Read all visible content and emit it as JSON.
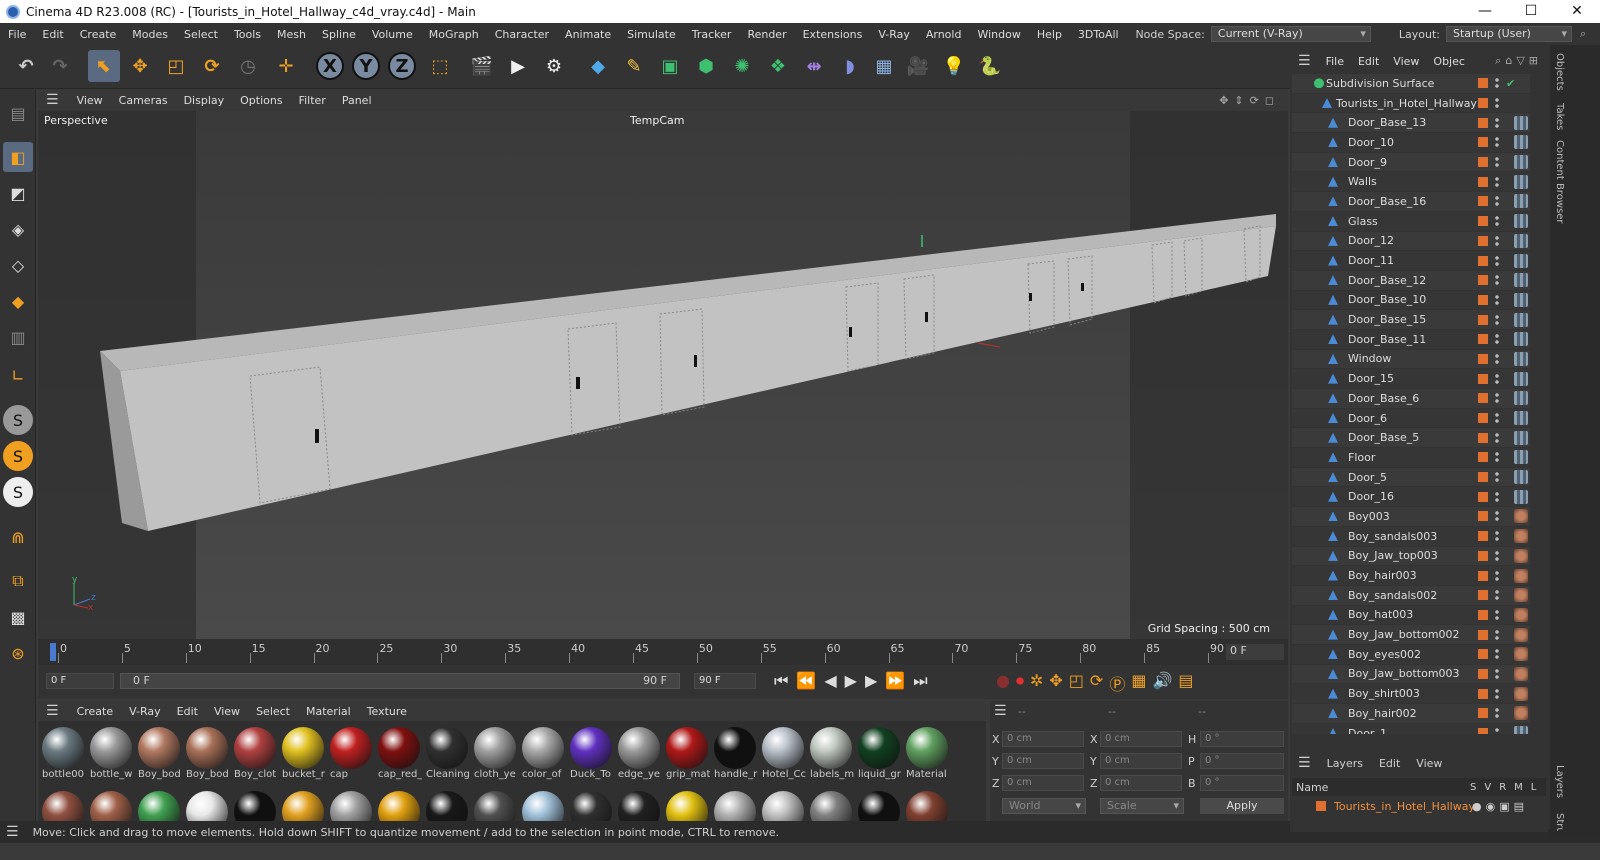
{
  "window": {
    "title": "Cinema 4D R23.008 (RC) - [Tourists_in_Hotel_Hallway_c4d_vray.c4d] - Main",
    "min": "—",
    "max": "☐",
    "close": "✕"
  },
  "menu": [
    "File",
    "Edit",
    "Create",
    "Modes",
    "Select",
    "Tools",
    "Mesh",
    "Spline",
    "Volume",
    "MoGraph",
    "Character",
    "Animate",
    "Simulate",
    "Tracker",
    "Render",
    "Extensions",
    "V-Ray",
    "Arnold",
    "Window",
    "Help",
    "3DToAll"
  ],
  "nodespace": {
    "label": "Node Space:",
    "value": "Current (V-Ray)"
  },
  "layout": {
    "label": "Layout:",
    "value": "Startup (User)"
  },
  "toolbar": {
    "x": "X",
    "y": "Y",
    "z": "Z"
  },
  "viewport": {
    "menu": [
      "View",
      "Cameras",
      "Display",
      "Options",
      "Filter",
      "Panel"
    ],
    "name": "Perspective",
    "camera": "TempCam",
    "grid": "Grid Spacing : 500 cm"
  },
  "timeline": {
    "ticks": [
      "0",
      "5",
      "10",
      "15",
      "20",
      "25",
      "30",
      "35",
      "40",
      "45",
      "50",
      "55",
      "60",
      "65",
      "70",
      "75",
      "80",
      "85",
      "90"
    ],
    "current": "0 F"
  },
  "transport": {
    "start": "0 F",
    "range_start": "0 F",
    "range_end": "90 F",
    "end": "90 F"
  },
  "matmenu": [
    "Create",
    "V-Ray",
    "Edit",
    "View",
    "Select",
    "Material",
    "Texture"
  ],
  "materials": [
    {
      "name": "bottle00",
      "color": "#6a7a80"
    },
    {
      "name": "bottle_w",
      "color": "#9a9a9a"
    },
    {
      "name": "Boy_bod",
      "color": "#b07860"
    },
    {
      "name": "Boy_bod",
      "color": "#a87058"
    },
    {
      "name": "Boy_clot",
      "color": "#b04040"
    },
    {
      "name": "bucket_r",
      "color": "#e0c020"
    },
    {
      "name": "cap",
      "color": "#c02020"
    },
    {
      "name": "cap_red_",
      "color": "#801010"
    },
    {
      "name": "Cleaning",
      "color": "#303030"
    },
    {
      "name": "cloth_ye",
      "color": "#a0a0a0"
    },
    {
      "name": "color_of",
      "color": "#a8a8a8"
    },
    {
      "name": "Duck_To",
      "color": "#6030c0"
    },
    {
      "name": "edge_ye",
      "color": "#9a9a9a"
    },
    {
      "name": "grip_mat",
      "color": "#b01818"
    },
    {
      "name": "handle_r",
      "color": "#101010"
    },
    {
      "name": "Hotel_Cc",
      "color": "#b8c0c8"
    },
    {
      "name": "labels_m",
      "color": "#c0c8c0"
    },
    {
      "name": "liquid_gr",
      "color": "#104020"
    },
    {
      "name": "Material",
      "color": "#60a060"
    }
  ],
  "materials_row2": [
    "#905040",
    "#a06048",
    "#40a050",
    "#e8e8e8",
    "#101010",
    "#e0a020",
    "#a0a0a0",
    "#e0a010",
    "#181818",
    "#505050",
    "#a0c0d8",
    "#303030",
    "#202020",
    "#e0c010",
    "#b0b0b0",
    "#c0c0c0",
    "#808080",
    "#101010",
    "#804030"
  ],
  "coords": {
    "dashes": [
      "--",
      "--",
      "--"
    ],
    "x": "X",
    "y": "Y",
    "z": "Z",
    "h": "H",
    "p": "P",
    "b": "B",
    "pos": "0 cm",
    "rot": "0 °",
    "world": "World",
    "scale": "Scale",
    "apply": "Apply"
  },
  "status": "Move: Click and drag to move elements. Hold down SHIFT to quantize movement / add to the selection in point mode, CTRL to remove.",
  "objects": {
    "menu": [
      "File",
      "Edit",
      "View",
      "Objec"
    ],
    "items": [
      "Subdivision Surface",
      "Tourists_in_Hotel_Hallway",
      "Door_Base_13",
      "Door_10",
      "Door_9",
      "Walls",
      "Door_Base_16",
      "Glass",
      "Door_12",
      "Door_11",
      "Door_Base_12",
      "Door_Base_10",
      "Door_Base_15",
      "Door_Base_11",
      "Window",
      "Door_15",
      "Door_Base_6",
      "Door_6",
      "Door_Base_5",
      "Floor",
      "Door_5",
      "Door_16",
      "Boy003",
      "Boy_sandals003",
      "Boy_Jaw_top003",
      "Boy_hair003",
      "Boy_sandals002",
      "Boy_hat003",
      "Boy_Jaw_bottom002",
      "Boy_eyes002",
      "Boy_Jaw_bottom003",
      "Boy_shirt003",
      "Boy_hair002",
      "Door_1"
    ]
  },
  "layers": {
    "menu": [
      "Layers",
      "Edit",
      "View"
    ],
    "name_header": "Name",
    "cols": [
      "S",
      "V",
      "R",
      "M",
      "L"
    ],
    "item": "Tourists_in_Hotel_Hallway"
  },
  "sidetabs": [
    "Objects",
    "Takes",
    "Content Browser",
    "Layers",
    "Structure"
  ]
}
